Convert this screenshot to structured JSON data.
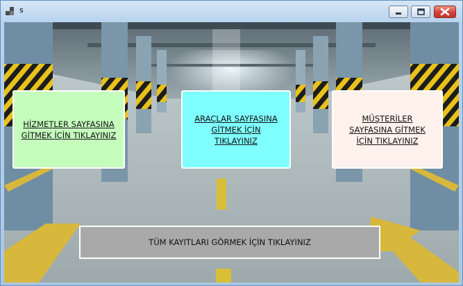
{
  "window": {
    "title": "s",
    "app_icon": "app-form-icon",
    "controls": {
      "minimize": "minimize-icon",
      "maximize": "maximize-icon",
      "close": "close-icon"
    }
  },
  "background": {
    "description_icon": "parking-garage-background"
  },
  "buttons": {
    "services": "HİZMETLER SAYFASINA GİTMEK İÇİN TIKLAYINIZ",
    "vehicles": "ARAÇLAR SAYFASINA GİTMEK İÇİN TIKLAYINIZ",
    "customers": "MÜŞTERİLER SAYFASINA GİTMEK İÇİN TIKLAYINIZ",
    "all_records": "TÜM KAYITLARI GÖRMEK İÇİN TIKLAYINIZ"
  },
  "colors": {
    "services_bg": "#c5fdbd",
    "vehicles_bg": "#7fffff",
    "customers_bg": "#fff2ec",
    "all_records_bg": "#a9a9a9"
  }
}
